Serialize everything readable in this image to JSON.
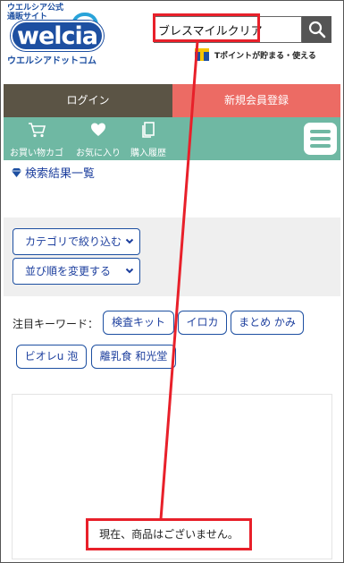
{
  "header": {
    "logo_small": "ウエルシア公式\n通販サイト",
    "logo_main": "welcia",
    "logo_sub": "ウエルシアドットコム",
    "search": {
      "value": "ブレスマイルクリア",
      "placeholder": ""
    },
    "tpoint_text": "Tポイントが貯まる・使える"
  },
  "auth": {
    "login_label": "ログイン",
    "register_label": "新規会員登録"
  },
  "nav": {
    "items": [
      {
        "label": "お買い物カゴ",
        "icon": "cart-icon"
      },
      {
        "label": "お気に入り",
        "icon": "heart-icon"
      },
      {
        "label": "購入履歴",
        "icon": "history-icon"
      }
    ]
  },
  "breadcrumb": {
    "label": "検索結果一覧"
  },
  "filters": {
    "category_label": "カテゴリで絞り込む",
    "sort_label": "並び順を変更する"
  },
  "keywords": {
    "label": "注目キーワード：",
    "chips": [
      "検査キット",
      "イロカ",
      "まとめ かみ",
      "ビオレu 泡",
      "離乳食 和光堂"
    ]
  },
  "results": {
    "empty_message": "現在、商品はございません。"
  },
  "colors": {
    "brand_blue": "#1d4fa1",
    "login_bg": "#5b5445",
    "register_bg": "#ec6b64",
    "nav_bg": "#6fb8a3",
    "annotation_red": "#e8202a"
  }
}
